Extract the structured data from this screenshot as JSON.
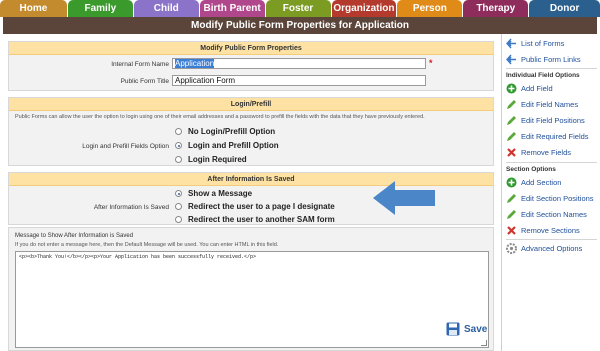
{
  "tabs": [
    {
      "label": "Home",
      "color": "#c38a2e"
    },
    {
      "label": "Family",
      "color": "#3a9a2c"
    },
    {
      "label": "Child",
      "color": "#8a73c9"
    },
    {
      "label": "Birth Parent",
      "color": "#b0468c"
    },
    {
      "label": "Foster",
      "color": "#7b9b22"
    },
    {
      "label": "Organization",
      "color": "#b33a2c"
    },
    {
      "label": "Person",
      "color": "#e08a17"
    },
    {
      "label": "Therapy",
      "color": "#8e2d5c"
    },
    {
      "label": "Donor",
      "color": "#2b5f8e"
    }
  ],
  "page_title": "Modify Public Form Properties for Application",
  "properties": {
    "header": "Modify Public Form Properties",
    "internal_name_label": "Internal Form Name",
    "internal_name_value": "Application",
    "required_mark": "*",
    "public_title_label": "Public Form Title",
    "public_title_value": "Application Form"
  },
  "login": {
    "header": "Login/Prefill",
    "description": "Public Forms can allow the user the option to login using one of their email addresses and a password to prefill the fields with the data that they have previously entered.",
    "field_label": "Login and Prefill Fields Option",
    "options": [
      "No Login/Prefill Option",
      "Login and Prefill Option",
      "Login Required"
    ],
    "selected_index": 1
  },
  "after_save": {
    "header": "After Information Is Saved",
    "field_label": "After Information Is Saved",
    "options": [
      "Show a Message",
      "Redirect the user to a page I designate",
      "Redirect the user to another SAM form"
    ],
    "selected_index": 0
  },
  "message": {
    "label": "Message to Show After Information is Saved",
    "help": "If you do not enter a message here, then the Default Message will be used. You can enter HTML in this field.",
    "value": "<p><b>Thank You!</b></p><p>Your Application has been successfully received.</p>"
  },
  "save_label": "Save",
  "sidebar": {
    "links": [
      {
        "label": "List of Forms",
        "icon": "back-arrow-icon"
      },
      {
        "label": "Public Form Links",
        "icon": "back-arrow-icon"
      }
    ],
    "field_heading": "Individual Field Options",
    "field_options": [
      {
        "label": "Add Field",
        "icon": "add-icon"
      },
      {
        "label": "Edit Field Names",
        "icon": "pencil-icon"
      },
      {
        "label": "Edit Field Positions",
        "icon": "pencil-icon"
      },
      {
        "label": "Edit Required Fields",
        "icon": "pencil-icon"
      },
      {
        "label": "Remove Fields",
        "icon": "remove-icon"
      }
    ],
    "section_heading": "Section Options",
    "section_options": [
      {
        "label": "Add Section",
        "icon": "add-icon"
      },
      {
        "label": "Edit Section Positions",
        "icon": "pencil-icon"
      },
      {
        "label": "Edit Section Names",
        "icon": "pencil-icon"
      },
      {
        "label": "Remove Sections",
        "icon": "remove-icon"
      }
    ],
    "advanced": {
      "label": "Advanced Options",
      "icon": "gear-icon"
    }
  }
}
